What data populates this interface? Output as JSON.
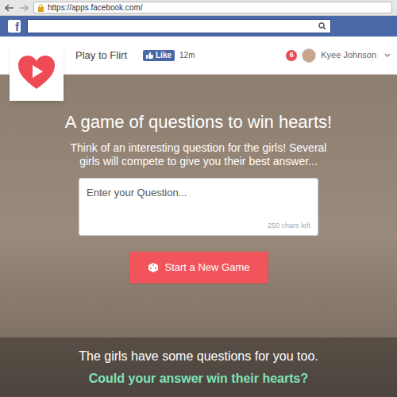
{
  "browser": {
    "url": "https://apps.facebook.com/"
  },
  "facebook": {
    "logo": "f"
  },
  "app": {
    "name": "Play to Flirt",
    "like": "Like",
    "like_count": "12m"
  },
  "user": {
    "notifications": "6",
    "name": "Kyee Johnson"
  },
  "hero": {
    "title": "A game of questions to win hearts!",
    "subtitle": "Think of an interesting question for the girls! Several girls will compete to give you their best answer...",
    "question": {
      "placeholder": "Enter your Question...",
      "counter": "250 chars left"
    },
    "button": "Start a New Game"
  },
  "footer": {
    "line1": "The girls have some questions for you too.",
    "line2": "Could your answer win their hearts?"
  }
}
